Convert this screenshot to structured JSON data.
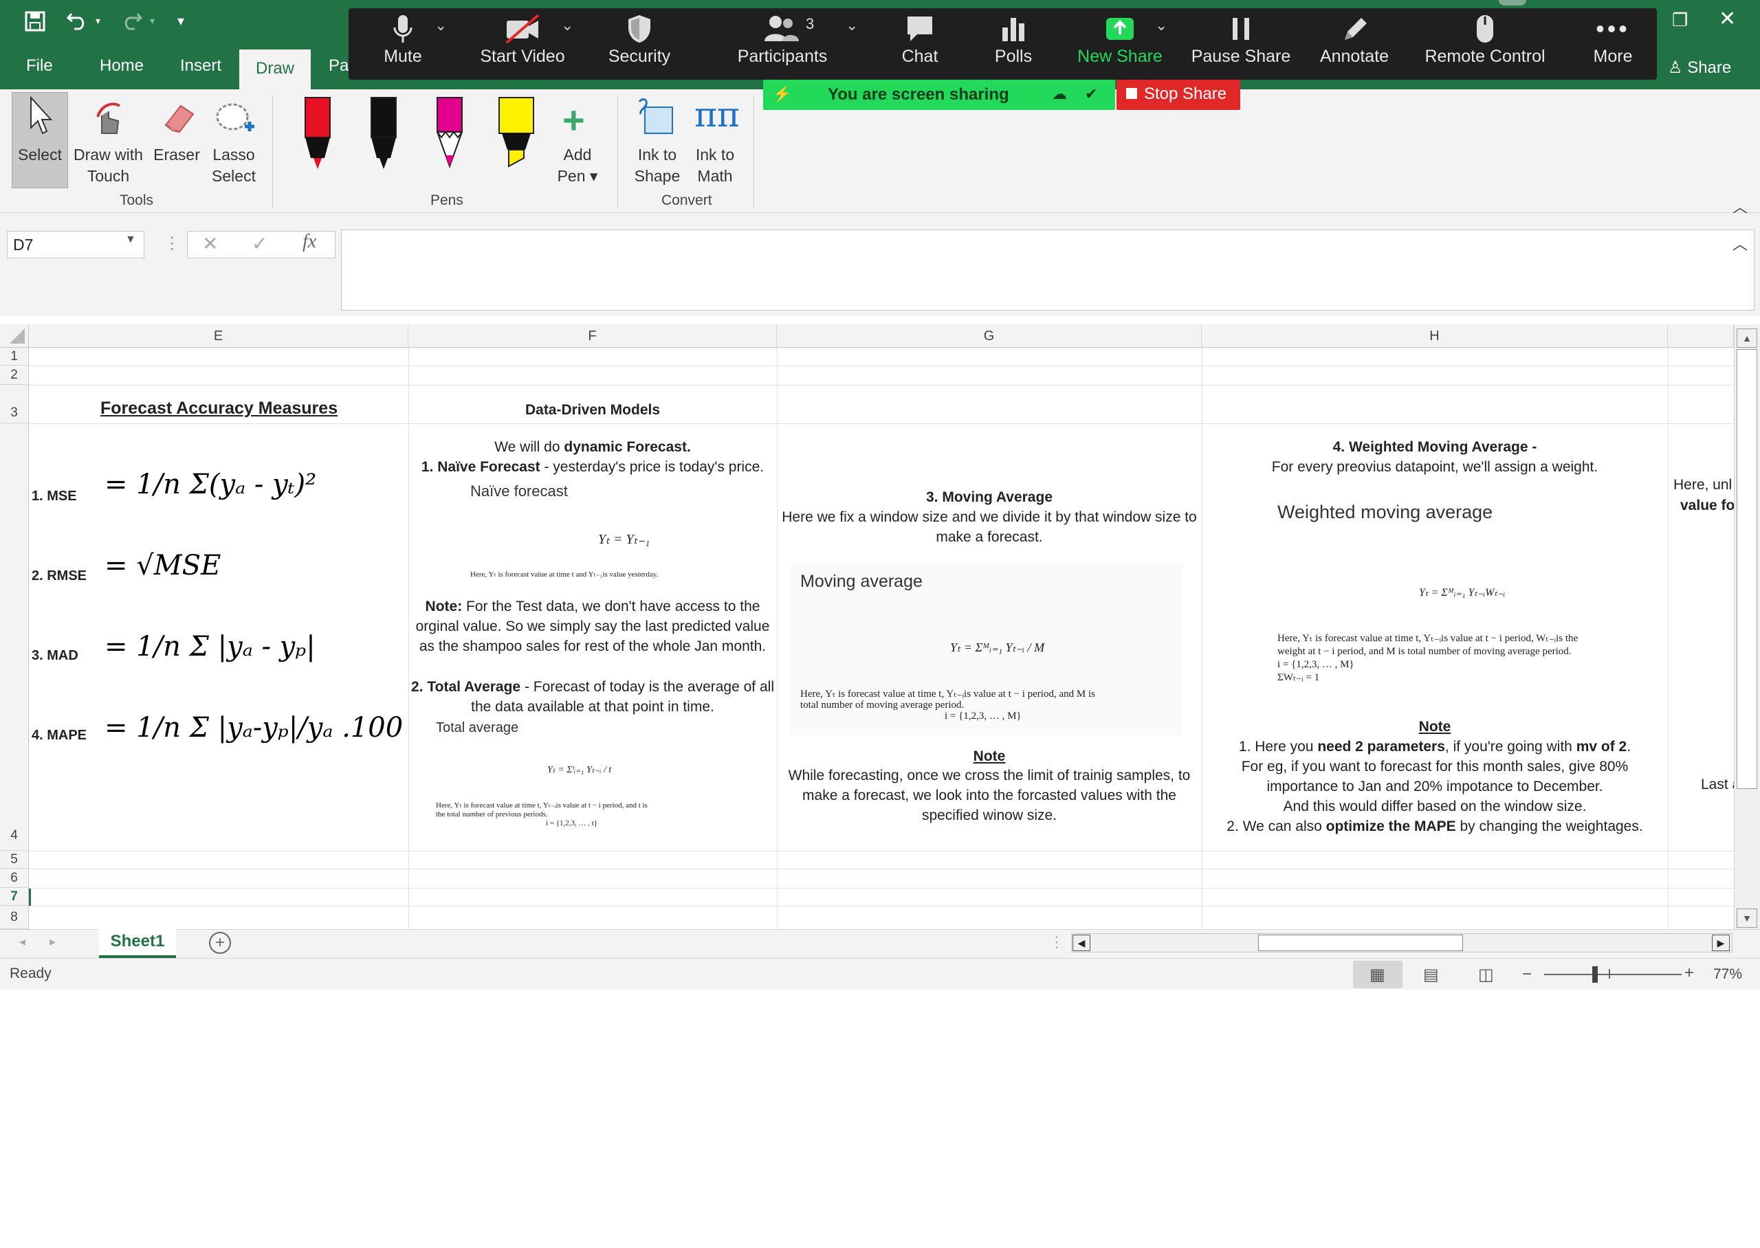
{
  "excel": {
    "tabs": [
      "File",
      "Home",
      "Insert",
      "Draw",
      "Pa"
    ],
    "active_tab": "Draw",
    "share_label": "Share",
    "ribbon": {
      "tools": {
        "select": "Select",
        "draw_touch_1": "Draw with",
        "draw_touch_2": "Touch",
        "eraser": "Eraser",
        "lasso_1": "Lasso",
        "lasso_2": "Select",
        "group": "Tools"
      },
      "pens": {
        "add_pen_1": "Add",
        "add_pen_2": "Pen",
        "group": "Pens"
      },
      "convert": {
        "ink_shape_1": "Ink to",
        "ink_shape_2": "Shape",
        "ink_math_1": "Ink to",
        "ink_math_2": "Math",
        "group": "Convert"
      }
    },
    "name_box": "D7",
    "fx": "fx",
    "columns": [
      "E",
      "F",
      "G",
      "H"
    ],
    "rows": [
      "1",
      "2",
      "3",
      "4",
      "5",
      "6",
      "7",
      "8"
    ],
    "sheet_tab": "Sheet1",
    "status": "Ready",
    "zoom": "77%",
    "colors": {
      "accent": "#217346",
      "zoom_bg": "#1f1f1f",
      "share_green": "#23d959",
      "stop_red": "#e02828"
    }
  },
  "zoom": {
    "buttons": [
      {
        "label": "Mute",
        "icon": "microphone-icon"
      },
      {
        "label": "Start Video",
        "icon": "video-off-icon"
      },
      {
        "label": "Security",
        "icon": "shield-icon"
      },
      {
        "label": "Participants",
        "icon": "participants-icon",
        "count": "3"
      },
      {
        "label": "Chat",
        "icon": "chat-icon"
      },
      {
        "label": "Polls",
        "icon": "polls-icon"
      },
      {
        "label": "New Share",
        "icon": "share-up-icon"
      },
      {
        "label": "Pause Share",
        "icon": "pause-icon"
      },
      {
        "label": "Annotate",
        "icon": "pencil-icon"
      },
      {
        "label": "Remote Control",
        "icon": "mouse-icon"
      },
      {
        "label": "More",
        "icon": "more-icon"
      }
    ],
    "sharing_banner": "You are screen sharing",
    "stop_share": "Stop Share"
  },
  "sheet": {
    "e_title": "Forecast Accuracy Measures",
    "mse_label": "1. MSE",
    "rmse_label": "2. RMSE",
    "mad_label": "3. MAD",
    "mape_label": "4. MAPE",
    "mse_formula": "= 1/n Σ(yₐ - yₜ)²",
    "rmse_formula": "= √MSE",
    "mad_formula": "= 1/n Σ |yₐ - yₚ|",
    "mape_formula": "= 1/n Σ |yₐ-yₚ|/yₐ .100",
    "f_title": "Data-Driven Models",
    "f_intro_1": "We will do ",
    "f_intro_1b": "dynamic Forecast.",
    "f_naive_b": "1. Naïve Forecast",
    "f_naive": " - yesterday's price is today's price.",
    "f_naive_img_title": "Naïve forecast",
    "f_naive_eq": "Yₜ = Yₜ₋₁",
    "f_naive_note": "Here, Yₜ is forecast value at time t and Yₜ₋₁is value yesterday.",
    "f_note_b": "Note:",
    "f_note_1": " For the Test data, we don't have access to the",
    "f_note_2": "orginal value. So we simply say the last predicted value",
    "f_note_3": "as the shampoo sales for rest of the whole Jan month.",
    "f_total_b": "2. Total Average",
    "f_total_1": " - Forecast of today is the average of all",
    "f_total_2": "the data available at that point in time.",
    "f_total_img_title": "Total average",
    "f_total_eq": "Yₜ = Σᵗᵢ₌₁ Yₜ₋ᵢ / t",
    "f_total_note_1": "Here, Yₜ is forecast value at time t, Yₜ₋ᵢis value at t − i period, and t is",
    "f_total_note_2": "the total number of previous periods.",
    "f_total_note_3": "i = {1,2,3, … , t}",
    "g_title": "3. Moving Average",
    "g_desc_1": "Here we fix a window size and we divide it by that window size to",
    "g_desc_2": "make a forecast.",
    "g_img_title": "Moving average",
    "g_eq": "Yₜ = Σᴹᵢ₌₁ Yₜ₋ᵢ / M",
    "g_note_small_1": "Here, Yₜ is forecast value at time t, Yₜ₋ᵢis value at t − i period, and M is",
    "g_note_small_2": "total number of moving average period.",
    "g_note_small_3": "i = {1,2,3, … , M}",
    "g_note_head": "Note",
    "g_note_1": "While forecasting, once we cross the limit of trainig samples, to",
    "g_note_2": "make a forecast, we look into the forcasted values with the",
    "g_note_3": "specified winow size.",
    "h_title": "4. Weighted Moving Average -",
    "h_desc": "For every preovius datapoint, we'll assign a weight.",
    "h_img_title": "Weighted moving average",
    "h_eq": "Yₜ = Σᴹᵢ₌₁ Yₜ₋ᵢWₜ₋ᵢ",
    "h_small_1": "Here, Yₜ is forecast value at time t, Yₜ₋ᵢis value at t − i period, Wₜ₋ᵢis the",
    "h_small_2": "weight at t − i period, and M is total number of moving average period.",
    "h_small_3": "i = {1,2,3, … , M}",
    "h_small_4": "ΣWₜ₋ᵢ = 1",
    "h_note_head": "Note",
    "h_note_1a": "1. Here you ",
    "h_note_1b": "need 2 parameters",
    "h_note_1c": ", if you're going with ",
    "h_note_1d": "mv of 2",
    "h_note_1e": ".",
    "h_note_2": "For eg, if you want to forecast for this month sales, give 80%",
    "h_note_3": "importance to Jan and 20% impotance to December.",
    "h_note_4": "And this would differ based on the window size.",
    "h_note_5a": "2. We can also ",
    "h_note_5b": "optimize the MAPE",
    "h_note_5c": " by changing the weightages.",
    "i_text_1": "Here, unl",
    "i_text_2": "value fo",
    "i_text_3": "Last a"
  }
}
